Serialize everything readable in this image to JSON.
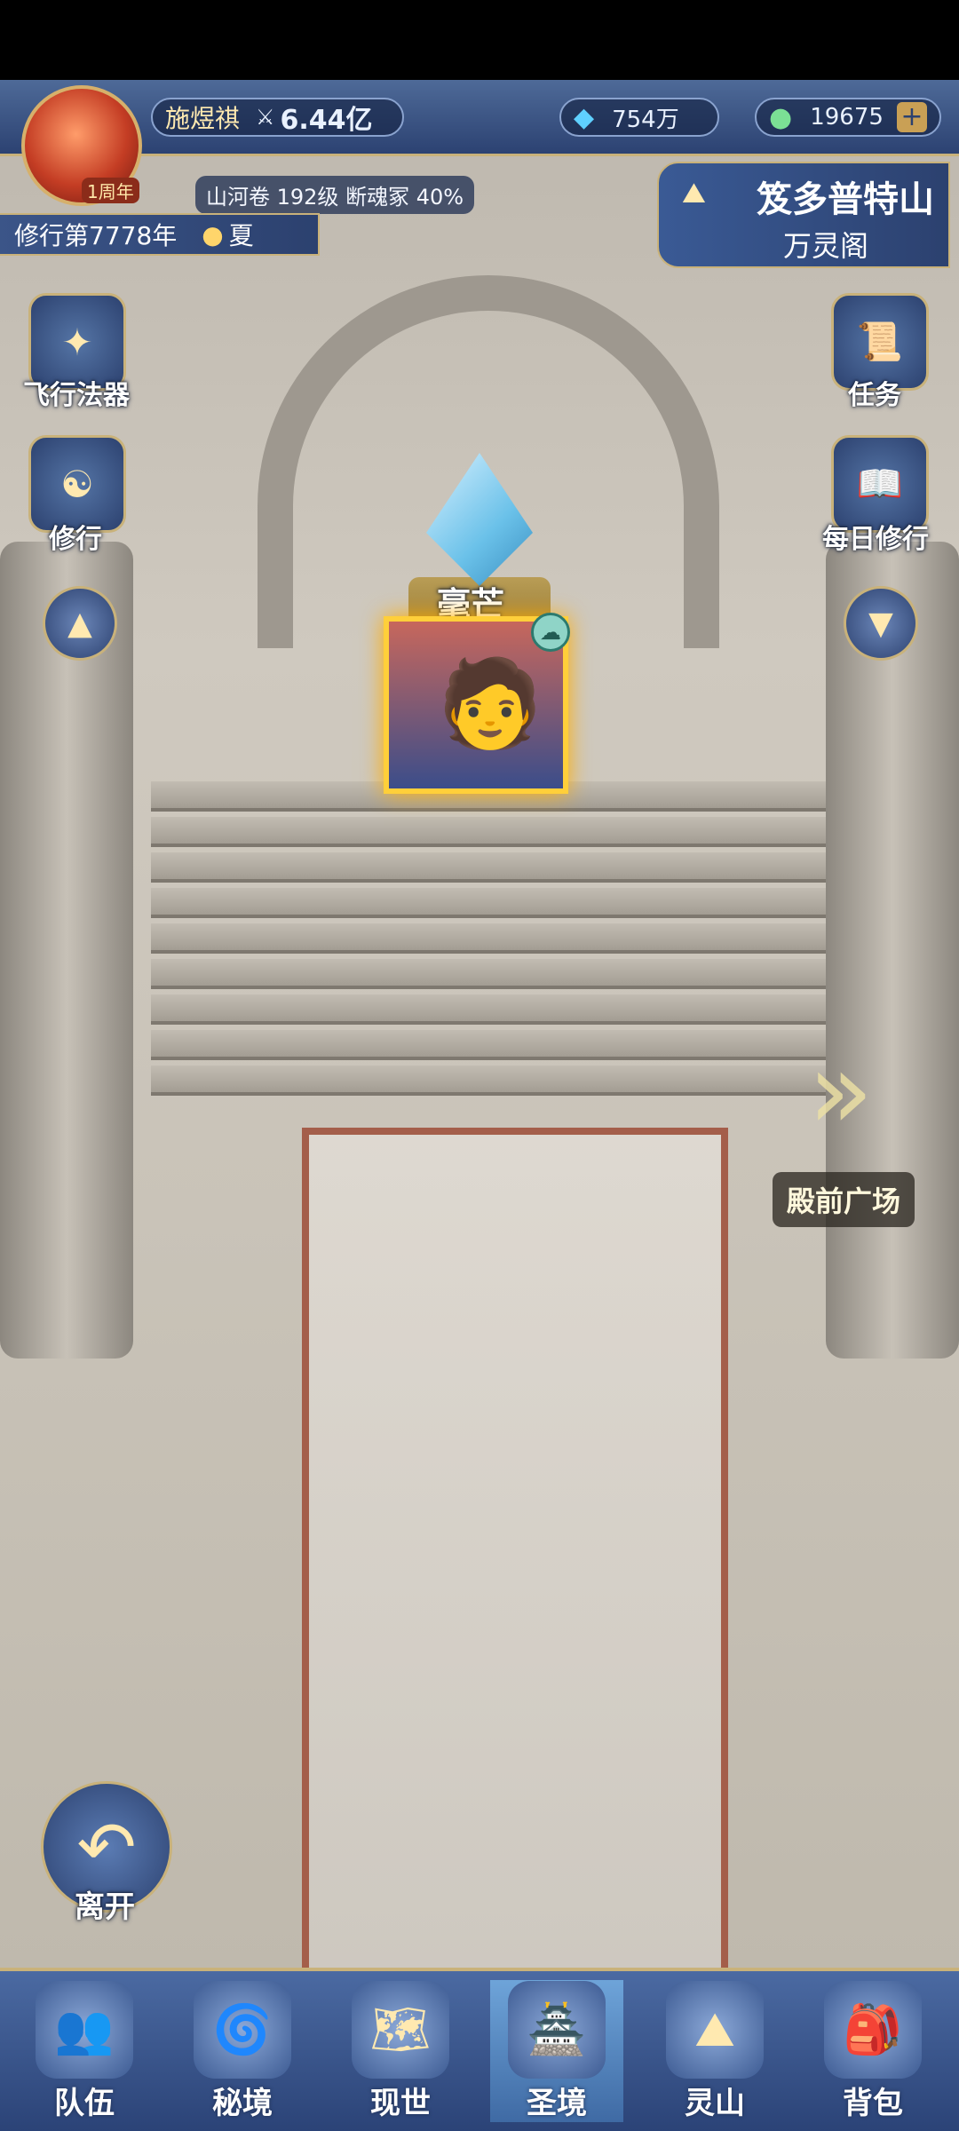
{
  "player": {
    "name": "施煜祺",
    "power": "6.44亿",
    "level_info": "山河卷 192级 断魂冢 40%",
    "year": "修行第7778年",
    "season": "夏",
    "badge": "1周年"
  },
  "currency": {
    "crystals": "754万",
    "jade": "19675"
  },
  "location": {
    "region": "笈多普特山",
    "place": "万灵阁"
  },
  "left_buttons": [
    {
      "label": "飞行法器",
      "icon": "flying-artifact-icon"
    },
    {
      "label": "修行",
      "icon": "cultivation-icon"
    }
  ],
  "right_buttons": [
    {
      "label": "任务",
      "icon": "quest-icon"
    },
    {
      "label": "每日修行",
      "icon": "daily-cultivation-icon"
    }
  ],
  "npc": {
    "name": "毫芒"
  },
  "portal": {
    "label": "殿前广场"
  },
  "leave": {
    "label": "离开"
  },
  "bottom_tabs": [
    {
      "label": "队伍",
      "icon": "team-icon"
    },
    {
      "label": "秘境",
      "icon": "secret-realm-icon"
    },
    {
      "label": "现世",
      "icon": "world-icon"
    },
    {
      "label": "圣境",
      "icon": "sacred-realm-icon",
      "active": true
    },
    {
      "label": "灵山",
      "icon": "spirit-mountain-icon"
    },
    {
      "label": "背包",
      "icon": "backpack-icon"
    }
  ],
  "colors": {
    "frame_blue": "#2c4272",
    "gold": "#c9b27a"
  }
}
